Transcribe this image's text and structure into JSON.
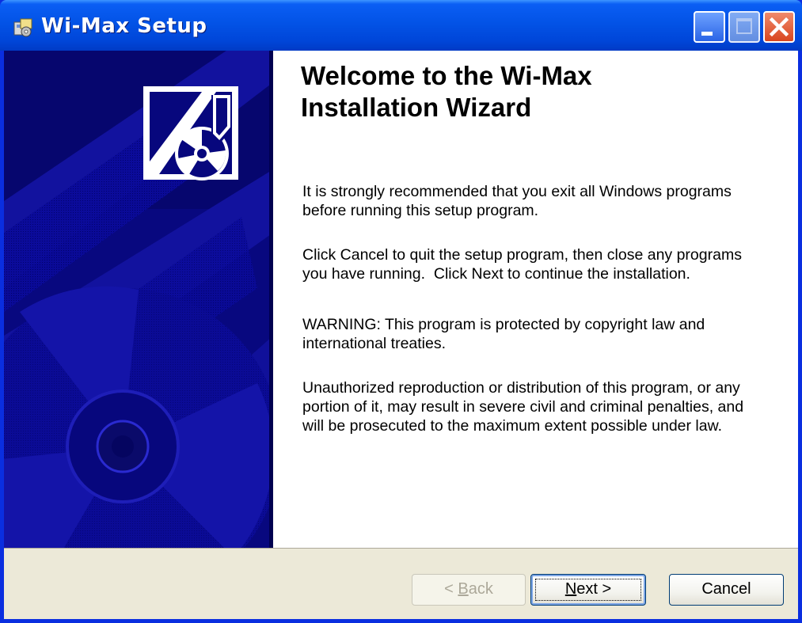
{
  "window": {
    "title": "Wi-Max Setup"
  },
  "welcome": {
    "title_line1": "Welcome to the Wi-Max",
    "title_line2": "Installation Wizard"
  },
  "paragraphs": {
    "p1_line1": "It is strongly recommended that you exit all Windows programs",
    "p1_line2": "before running this setup program.",
    "p2_line1": "Click Cancel to quit the setup program, then close any programs",
    "p2_line2": "you have running.  Click Next to continue the installation.",
    "p3_line1": "WARNING: This program is protected by copyright law and",
    "p3_line2": "international treaties.",
    "p4_line1": "Unauthorized reproduction or distribution of this program, or any",
    "p4_line2": "portion of it, may result in severe civil and criminal penalties, and",
    "p4_line3": "will be prosecuted to the maximum extent possible under law."
  },
  "buttons": {
    "back_prefix": "< ",
    "back_accel": "B",
    "back_rest": "ack",
    "next_accel": "N",
    "next_rest": "ext >",
    "cancel": "Cancel",
    "back_enabled": false
  },
  "colors": {
    "titlebar": "#0353e6",
    "banner": "#07077d",
    "footer": "#ece9d8"
  },
  "icons": {
    "title": "setup-installer-icon",
    "banner_logo": "cd-install-logo-icon"
  }
}
